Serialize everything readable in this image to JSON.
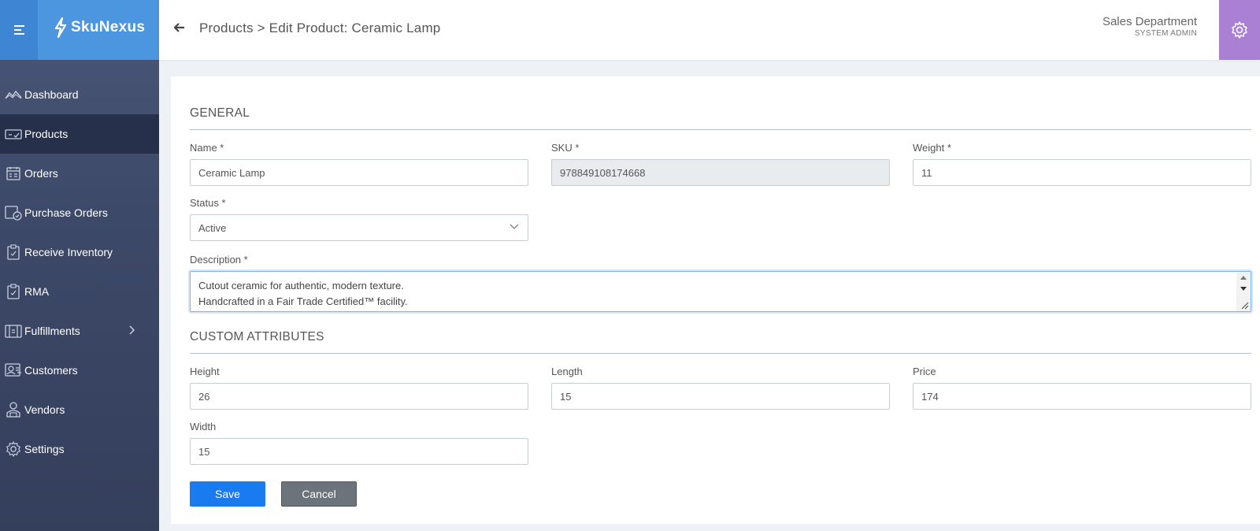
{
  "brand": {
    "name": "SkuNexus"
  },
  "nav": [
    {
      "label": "Dashboard",
      "icon": "dashboard-icon"
    },
    {
      "label": "Products",
      "icon": "products-icon",
      "active": true
    },
    {
      "label": "Orders",
      "icon": "orders-icon"
    },
    {
      "label": "Purchase Orders",
      "icon": "purchase-orders-icon"
    },
    {
      "label": "Receive Inventory",
      "icon": "receive-inventory-icon"
    },
    {
      "label": "RMA",
      "icon": "rma-icon"
    },
    {
      "label": "Fulfillments",
      "icon": "fulfillments-icon",
      "has_children": true
    },
    {
      "label": "Customers",
      "icon": "customers-icon"
    },
    {
      "label": "Vendors",
      "icon": "vendors-icon"
    },
    {
      "label": "Settings",
      "icon": "settings-icon"
    }
  ],
  "header": {
    "breadcrumb_root": "Products",
    "breadcrumb_separator": " > ",
    "breadcrumb_current": "Edit Product: Ceramic Lamp",
    "user_department": "Sales Department",
    "user_role": "SYSTEM ADMIN"
  },
  "general": {
    "title": "GENERAL",
    "name_label": "Name *",
    "name_value": "Ceramic Lamp",
    "sku_label": "SKU *",
    "sku_value": "978849108174668",
    "weight_label": "Weight *",
    "weight_value": "11",
    "status_label": "Status *",
    "status_value": "Active",
    "description_label": "Description *",
    "description_line1": "Cutout ceramic for authentic, modern texture.",
    "description_line2": "Handcrafted in a Fair Trade Certified™ facility."
  },
  "custom": {
    "title": "CUSTOM ATTRIBUTES",
    "height_label": "Height",
    "height_value": "26",
    "length_label": "Length",
    "length_value": "15",
    "price_label": "Price",
    "price_value": "174",
    "width_label": "Width",
    "width_value": "15"
  },
  "actions": {
    "save_label": "Save",
    "cancel_label": "Cancel"
  },
  "colors": {
    "brand_blue": "#4c96e0",
    "primary_button": "#1a7af0",
    "settings_purple": "#a980d4",
    "sidebar_active": "#27304a"
  }
}
